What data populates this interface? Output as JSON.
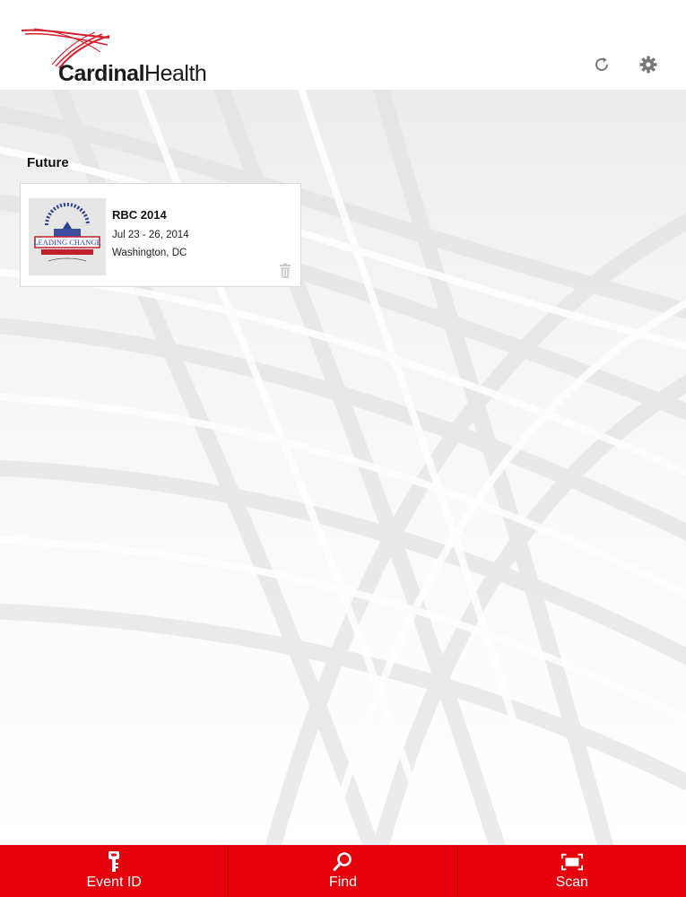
{
  "app": {
    "brand": "CardinalHealth",
    "brand_bold": "Cardinal",
    "brand_light": "Health"
  },
  "header": {
    "icons": [
      "refresh-icon",
      "gear-icon"
    ]
  },
  "events": {
    "section_title": "Future",
    "items": [
      {
        "name": "RBC 2014",
        "dates": "Jul 23 - 26, 2014",
        "location": "Washington, DC",
        "thumbnail_text": "LEADING CHANGE"
      }
    ]
  },
  "tabbar": {
    "tabs": [
      {
        "label": "Event ID",
        "icon": "key-icon"
      },
      {
        "label": "Find",
        "icon": "search-icon"
      },
      {
        "label": "Scan",
        "icon": "scan-icon"
      }
    ]
  },
  "colors": {
    "accent": "#e5000b",
    "logo_red": "#d81e2c"
  }
}
